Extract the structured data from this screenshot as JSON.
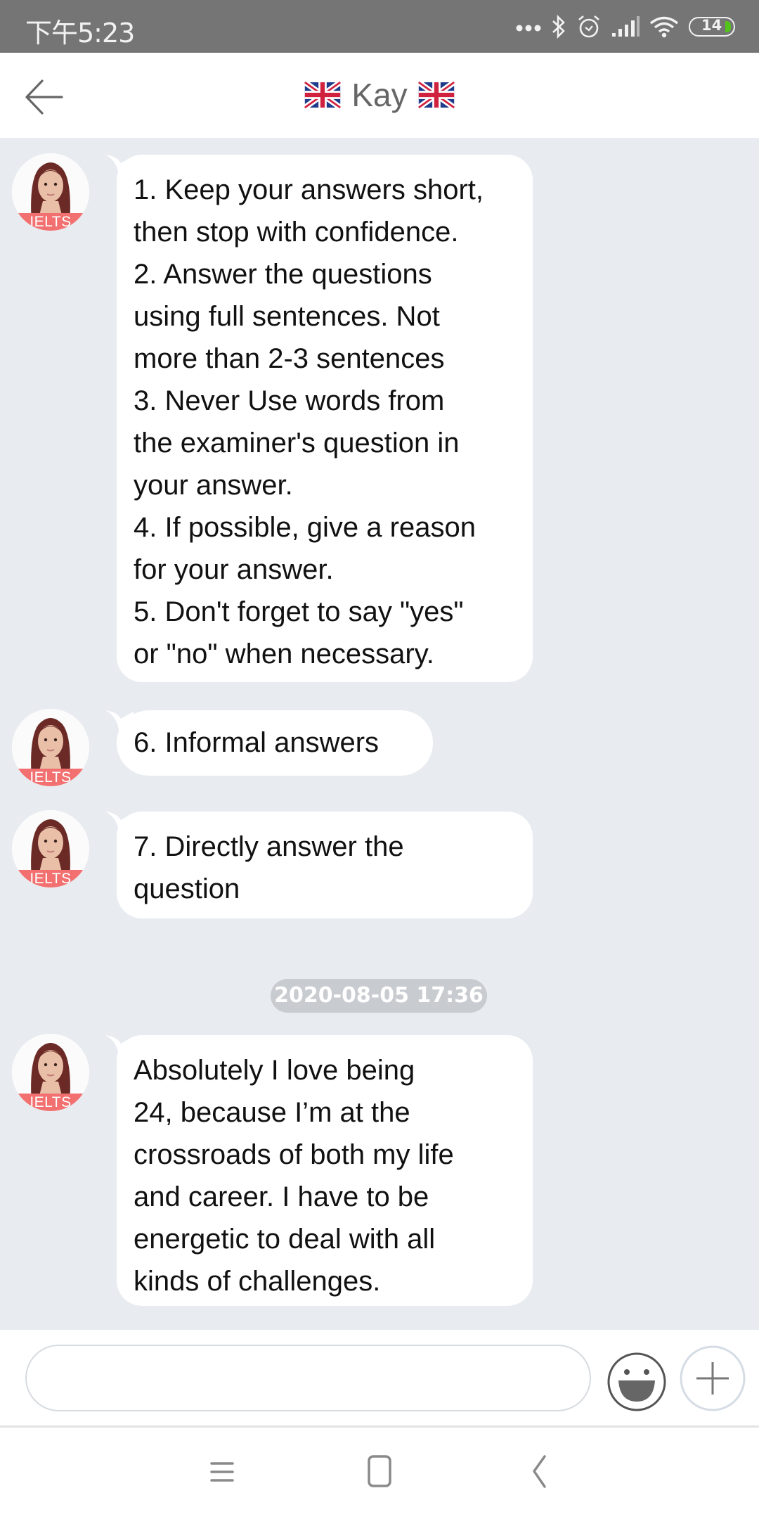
{
  "status_bar": {
    "time": "下午5:23",
    "icons": [
      "more-dots-icon",
      "bluetooth-icon",
      "alarm-icon",
      "signal-icon",
      "wifi-icon",
      "battery-icon"
    ],
    "battery_level": "14",
    "battery_color": "#52c41a"
  },
  "header": {
    "back_icon": "arrow-left-icon",
    "title": "Kay",
    "title_prefix_icon": "uk-flag-icon",
    "title_suffix_icon": "uk-flag-icon"
  },
  "chat": {
    "avatar_badge": "IELTS",
    "messages": [
      {
        "sender": "Kay",
        "lines": [
          "1. Keep your answers short,",
          "then stop with confidence.",
          "2. Answer the questions",
          "using full sentences. Not",
          "more than 2-3 sentences",
          "3. Never Use words from",
          "the examiner's question in",
          "your answer.",
          "4. If possible, give a reason",
          "for your answer.",
          "5. Don't forget to say \"yes\"",
          "or \"no\" when necessary."
        ]
      },
      {
        "sender": "Kay",
        "lines": [
          "6. Informal answers"
        ]
      },
      {
        "sender": "Kay",
        "lines": [
          "7. Directly answer the",
          "question"
        ]
      },
      {
        "sender": "Kay",
        "lines": [
          "Absolutely I love being",
          "24, because I’m at the",
          "crossroads of both my life",
          "and career. I have to be",
          "energetic to deal with all",
          "kinds of challenges."
        ]
      }
    ],
    "timestamp": "2020-08-05 17:36"
  },
  "input_bar": {
    "value": "",
    "placeholder": "",
    "emoji_icon": "smiley-icon",
    "plus_icon": "plus-icon"
  },
  "nav_bar": {
    "icons": [
      "menu-icon",
      "home-square-icon",
      "back-chevron-icon"
    ]
  },
  "colors": {
    "status_bar_bg": "#757575",
    "chat_bg": "#e8ebf0",
    "bubble_bg": "#ffffff",
    "badge_bg": "#f27070",
    "timestamp_bg": "#c8cbcf"
  }
}
